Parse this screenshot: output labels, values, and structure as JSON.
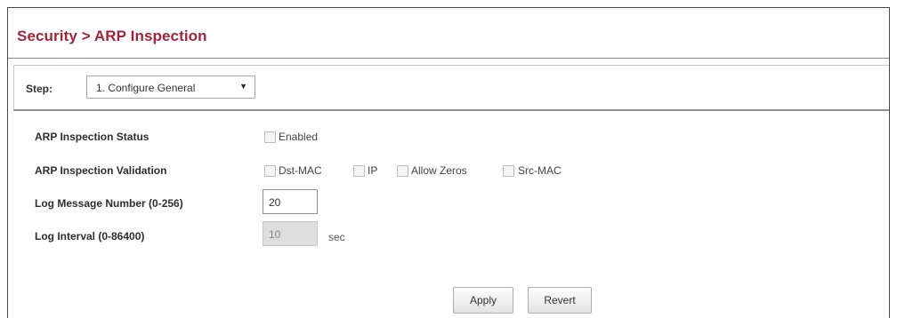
{
  "breadcrumb": {
    "title": "Security > ARP Inspection"
  },
  "step": {
    "label": "Step:",
    "selected": "1. Configure General"
  },
  "form": {
    "status": {
      "label": "ARP Inspection Status",
      "checkbox_label": "Enabled",
      "checked": false
    },
    "validation": {
      "label": "ARP Inspection Validation",
      "options": [
        {
          "label": "Dst-MAC",
          "checked": false
        },
        {
          "label": "IP",
          "checked": false
        },
        {
          "label": "Allow Zeros",
          "checked": false
        },
        {
          "label": "Src-MAC",
          "checked": false
        }
      ]
    },
    "log_number": {
      "label": "Log Message Number (0-256)",
      "value": "20"
    },
    "log_interval": {
      "label": "Log Interval (0-86400)",
      "value": "10",
      "unit": "sec"
    }
  },
  "buttons": {
    "apply": "Apply",
    "revert": "Revert"
  },
  "colors": {
    "title": "#a3243b"
  }
}
